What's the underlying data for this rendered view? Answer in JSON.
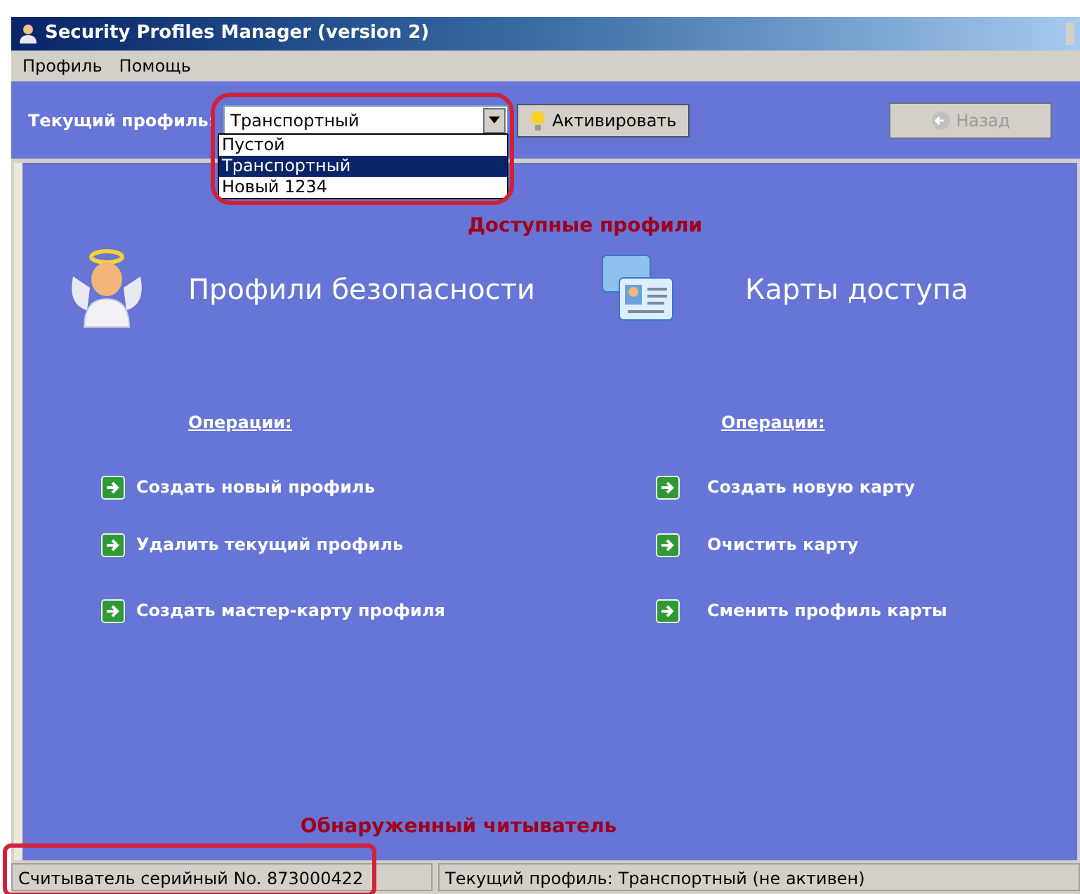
{
  "window": {
    "title": "Security Profiles Manager (version 2)"
  },
  "menu": [
    "Профиль",
    "Помощь"
  ],
  "toolbar": {
    "label": "Текущий профиль:",
    "combo_value": "Транспортный",
    "options": [
      {
        "label": "Пустой",
        "selected": false
      },
      {
        "label": "Транспортный",
        "selected": true
      },
      {
        "label": "Новый 1234",
        "selected": false
      }
    ],
    "activate": "Активировать",
    "back": {
      "label": "Назад",
      "disabled": true
    }
  },
  "annotations": {
    "profiles": "Доступные профили",
    "reader": "Обнаруженный читыватель"
  },
  "sections": [
    {
      "kind": "profiles",
      "title": "Профили безопасности",
      "ops_title": "Операции:",
      "ops": [
        "Создать новый профиль",
        "Удалить текущий профиль",
        "Создать мастер-карту профиля"
      ]
    },
    {
      "kind": "cards",
      "title": "Карты доступа",
      "ops_title": "Операции:",
      "ops": [
        "Создать новую карту",
        "Очистить карту",
        "Сменить профиль карты"
      ]
    }
  ],
  "status_bar": [
    "Считыватель серийный No. 873000422",
    "Текущий профиль:  Транспортный  (не активен)"
  ]
}
